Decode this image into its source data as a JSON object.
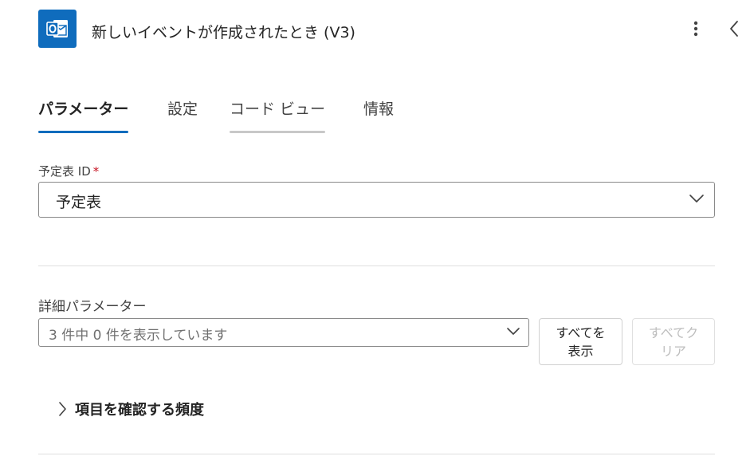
{
  "header": {
    "title": "新しいイベントが作成されたとき (V3)",
    "app_icon": "outlook-icon",
    "accent_color": "#0f6cbd"
  },
  "tabs": [
    {
      "label": "パラメーター",
      "state": "active"
    },
    {
      "label": "設定",
      "state": "default"
    },
    {
      "label": "コード ビュー",
      "state": "hover"
    },
    {
      "label": "情報",
      "state": "default"
    }
  ],
  "calendar_field": {
    "label": "予定表 ID",
    "required_mark": "*",
    "value": "予定表"
  },
  "advanced": {
    "label": "詳細パラメーター",
    "summary": "3 件中 0 件を表示しています",
    "show_all_line1": "すべてを",
    "show_all_line2": "表示",
    "clear_all_line1": "すべてク",
    "clear_all_line2": "リア"
  },
  "section": {
    "title": "項目を確認する頻度"
  }
}
